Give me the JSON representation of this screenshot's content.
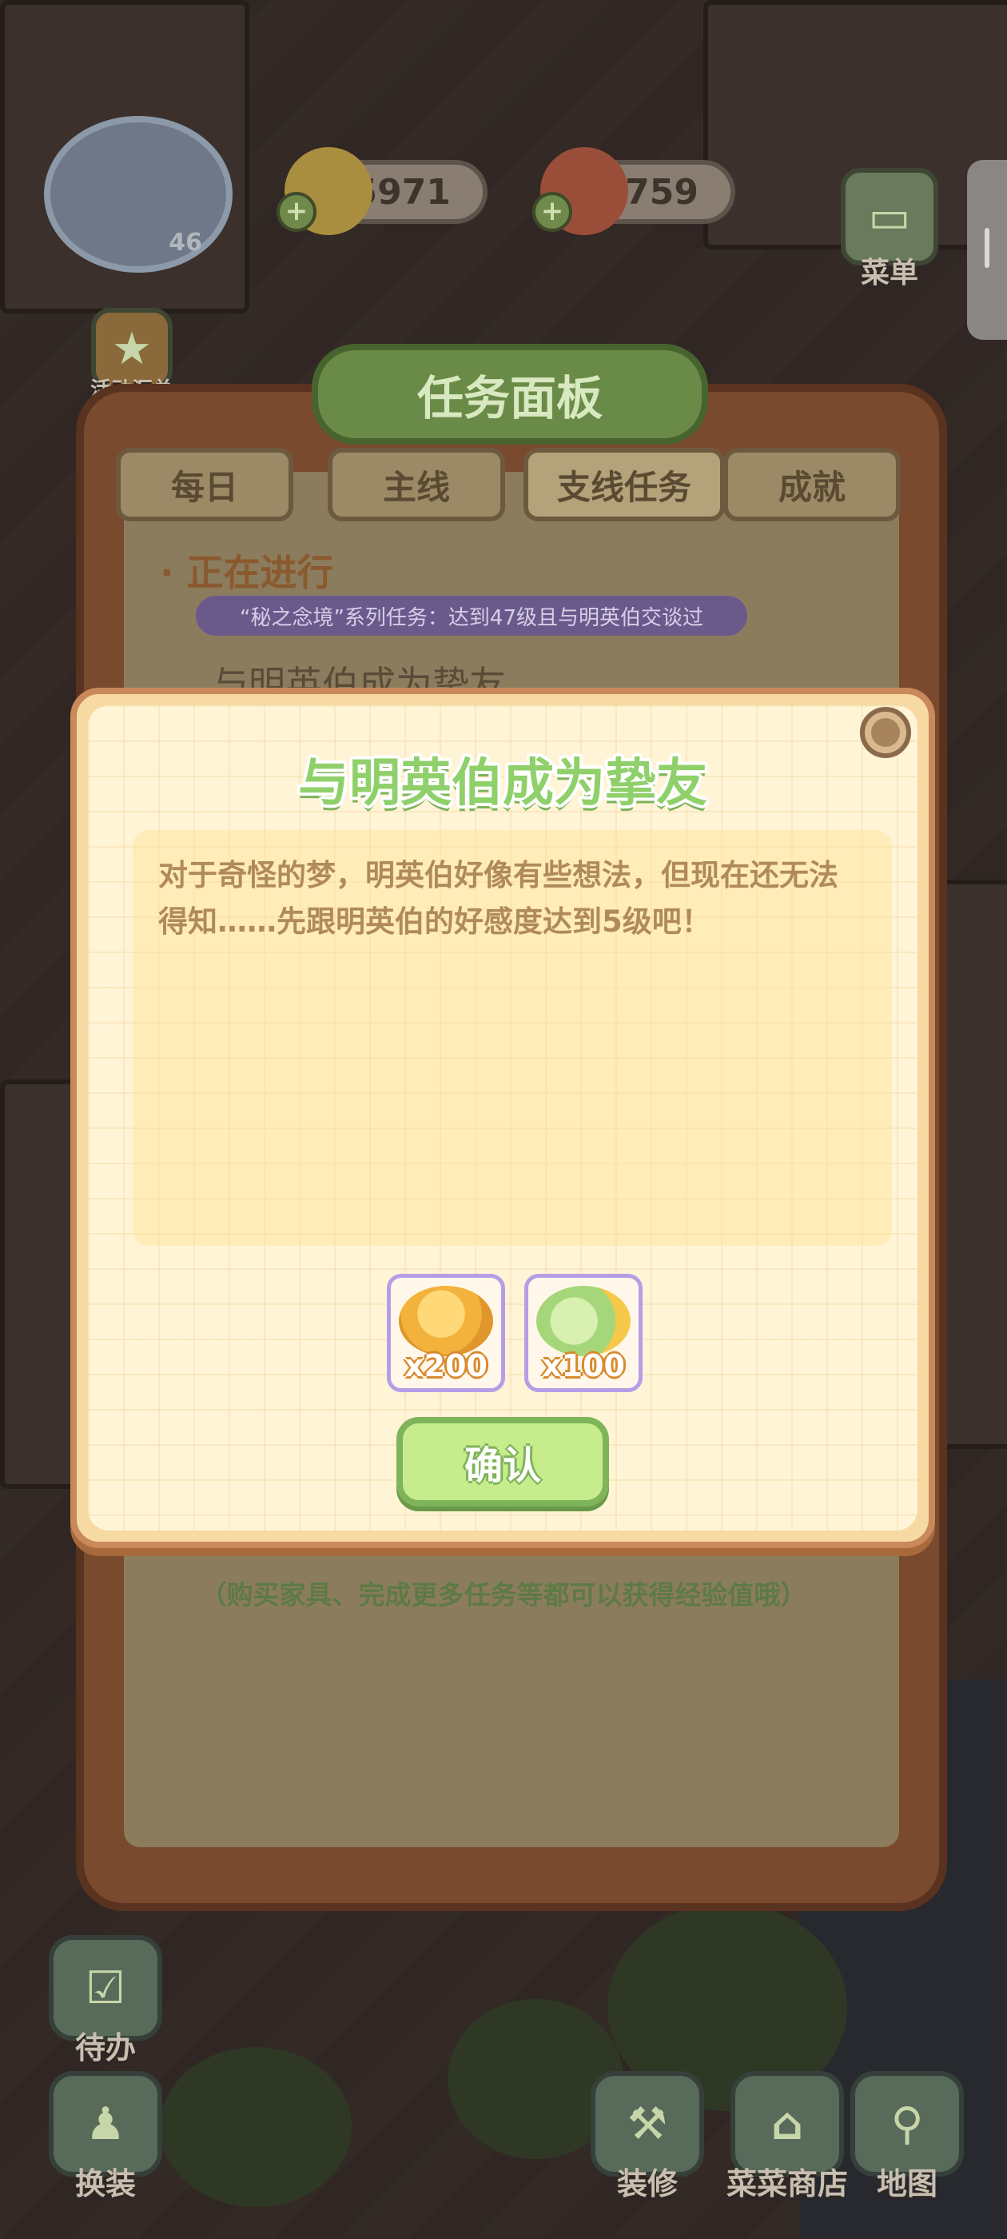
{
  "hud": {
    "player_level": "46",
    "coins": "5971",
    "vegetables": "759",
    "menu_label": "菜单",
    "events_label": "活动汇总"
  },
  "panel": {
    "title": "任务面板",
    "tabs": [
      "每日",
      "主线",
      "支线任务",
      "成就"
    ],
    "active_tab": "支线任务",
    "section_label": "· 正在进行",
    "series_banner": "“秘之念境”系列任务：达到47级且与明英伯交谈过",
    "task_name_partial": "与明英伯成为挚友",
    "hint": "（购买家具、完成更多任务等都可以获得经验值哦）"
  },
  "bottom": {
    "todo": "待办",
    "dressup": "换装",
    "decorate": "装修",
    "shop": "菜菜商店",
    "map": "地图"
  },
  "modal": {
    "title": "与明英伯成为挚友",
    "description": "对于奇怪的梦，明英伯好像有些想法，但现在还无法得知……先跟明英伯的好感度达到5级吧！",
    "rewards": [
      {
        "icon": "gold-coins-icon",
        "qty": "x200"
      },
      {
        "icon": "vegetable-exp-icon",
        "qty": "x100"
      }
    ],
    "confirm_label": "确认"
  },
  "colors": {
    "title_green": "#8fd06a",
    "modal_bg": "#fff4d6",
    "modal_border": "#c9895a",
    "confirm_green": "#c6ec8c"
  }
}
